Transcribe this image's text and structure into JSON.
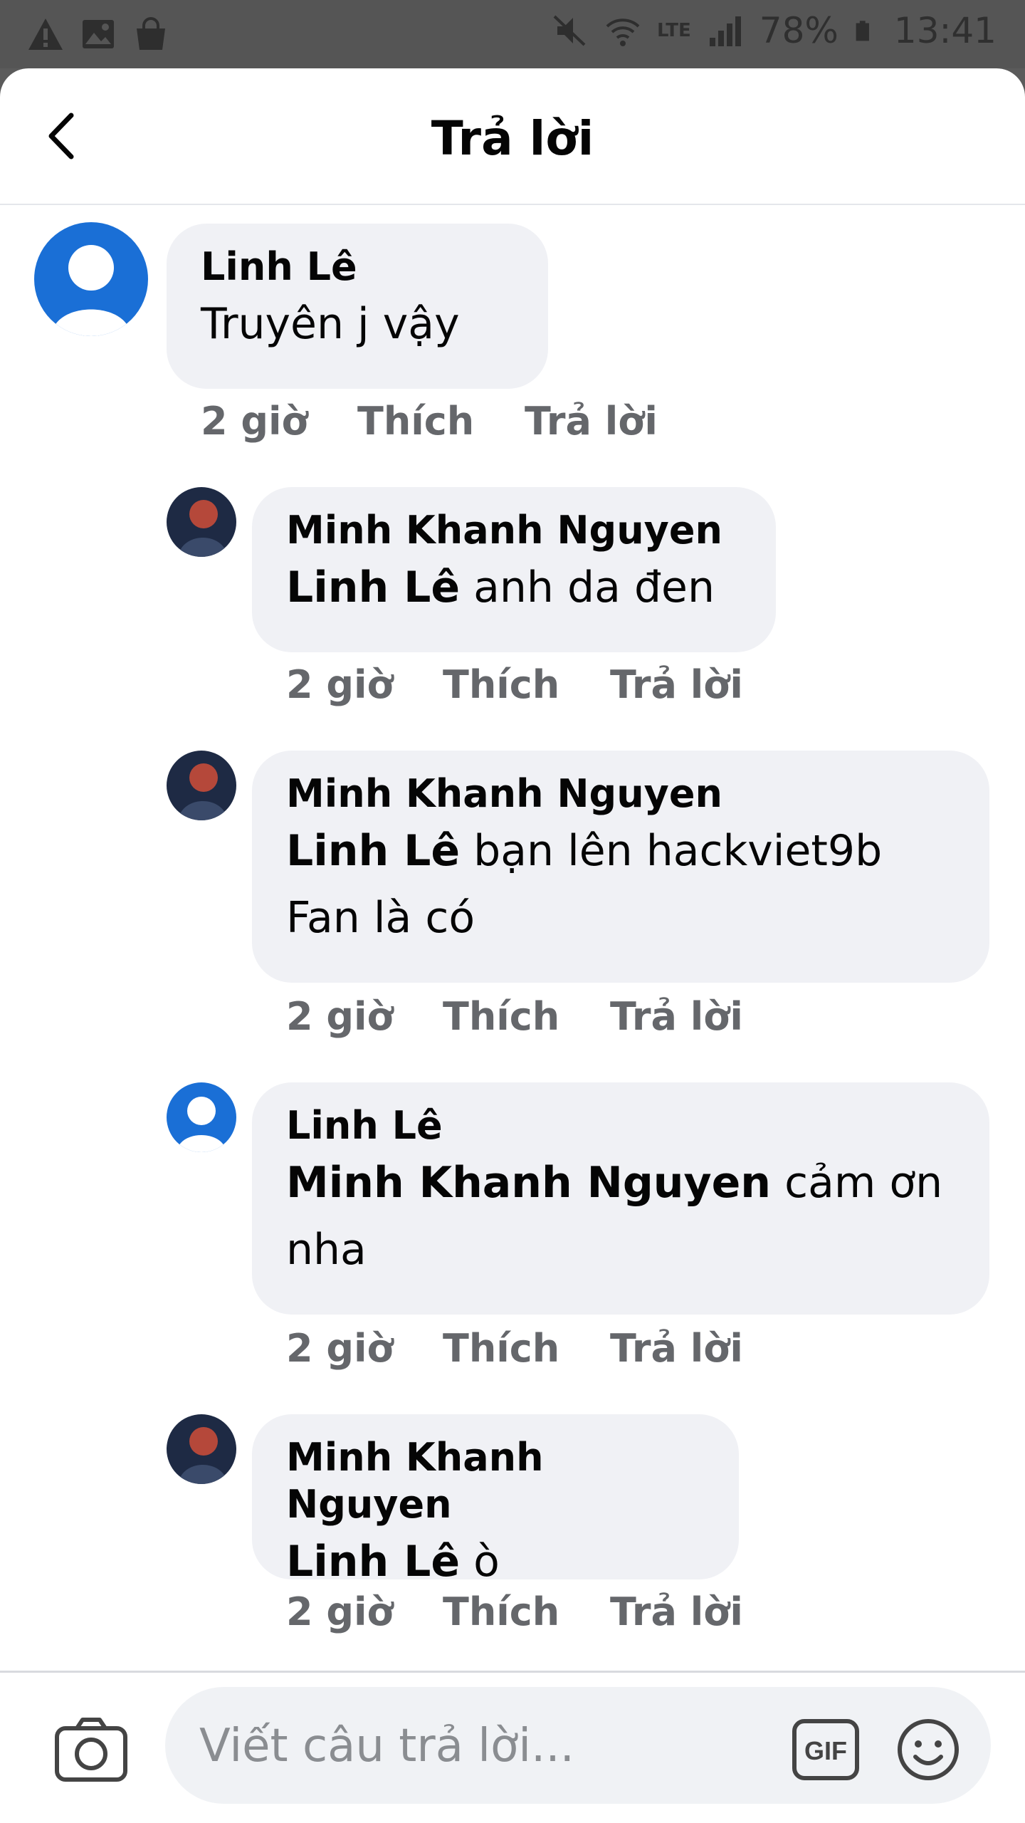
{
  "status_bar": {
    "battery": "78%",
    "time": "13:41",
    "network": "LTE"
  },
  "header": {
    "title": "Trả lời"
  },
  "comments": [
    {
      "author": "Linh Lê",
      "mention": "",
      "text": "Truyên j vậy",
      "time": "2 giờ",
      "like": "Thích",
      "reply": "Trả lời"
    },
    {
      "author": "Minh Khanh Nguyen",
      "mention": "Linh Lê",
      "text": " anh da đen",
      "time": "2 giờ",
      "like": "Thích",
      "reply": "Trả lời"
    },
    {
      "author": "Minh Khanh Nguyen",
      "mention": "Linh Lê",
      "text": " bạn lên hackviet9b Fan là có",
      "time": "2 giờ",
      "like": "Thích",
      "reply": "Trả lời"
    },
    {
      "author": "Linh Lê",
      "mention": "Minh Khanh Nguyen",
      "text": " cảm ơn nha",
      "time": "2 giờ",
      "like": "Thích",
      "reply": "Trả lời"
    },
    {
      "author": "Minh Khanh Nguyen",
      "mention": "Linh Lê",
      "text": " ò",
      "time": "2 giờ",
      "like": "Thích",
      "reply": "Trả lời"
    }
  ],
  "composer": {
    "placeholder": "Viết câu trả lời...",
    "gif_label": "GIF"
  },
  "colors": {
    "bubble": "#f0f1f5",
    "meta_text": "#65676b",
    "avatar_blue": "#1a6fd6"
  }
}
